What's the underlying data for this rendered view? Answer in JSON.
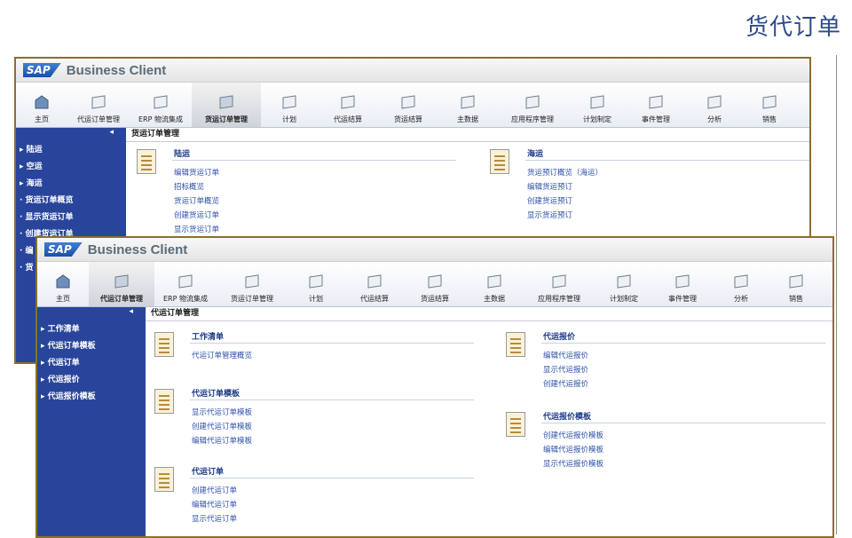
{
  "slide_title": "货代订单",
  "app": {
    "logo_text": "SAP",
    "name": "Business Client"
  },
  "toolbar": {
    "items": [
      "主页",
      "代运订单管理",
      "ERP 物流集成",
      "货运订单管理",
      "计划",
      "代运结算",
      "货运结算",
      "主数据",
      "应用程序管理",
      "计划制定",
      "事件管理",
      "分析",
      "销售"
    ]
  },
  "back_window": {
    "active_tab": "货运订单管理",
    "section_title": "货运订单管理",
    "sidebar": [
      "陆运",
      "空运",
      "海运",
      "· 货运订单概览",
      "· 显示货运订单",
      "· 创建货运订单",
      "· 编",
      "· 货"
    ],
    "groups": [
      {
        "title": "陆运",
        "links": [
          "编辑货运订单",
          "招标概览",
          "货运订单概览",
          "创建货运订单",
          "显示货运订单"
        ]
      },
      {
        "title": "海运",
        "links": [
          "货运预订概览（海运）",
          "编辑货运预订",
          "创建货运预订",
          "显示货运预订"
        ]
      }
    ]
  },
  "front_window": {
    "active_tab": "代运订单管理",
    "section_title": "代运订单管理",
    "sidebar": [
      "工作清单",
      "代运订单模板",
      "代运订单",
      "代运报价",
      "代运报价模板"
    ],
    "groups": [
      {
        "title": "工作清单",
        "links": [
          "代运订单管理概览"
        ]
      },
      {
        "title": "代运订单模板",
        "links": [
          "显示代运订单模板",
          "创建代运订单模板",
          "编辑代运订单模板"
        ]
      },
      {
        "title": "代运订单",
        "links": [
          "创建代运订单",
          "编辑代运订单",
          "显示代运订单"
        ]
      },
      {
        "title": "代运报价",
        "links": [
          "编辑代运报价",
          "显示代运报价",
          "创建代运报价"
        ]
      },
      {
        "title": "代运报价模板",
        "links": [
          "创建代运报价模板",
          "编辑代运报价模板",
          "显示代运报价模板"
        ]
      }
    ]
  },
  "colors": {
    "sidebar": "#29459b",
    "window_border": "#8b6f2a",
    "link": "#2c4fa8"
  }
}
